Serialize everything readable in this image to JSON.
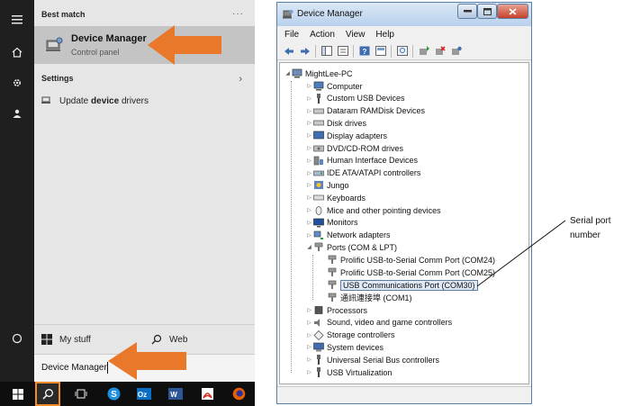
{
  "start_menu": {
    "best_match_title": "Best match",
    "more": "···",
    "best_match": {
      "title": "Device Manager",
      "subtitle": "Control panel"
    },
    "settings_title": "Settings",
    "update_drivers": {
      "before": "Update ",
      "bold": "device",
      "after": " drivers"
    },
    "my_stuff": "My stuff",
    "web": "Web",
    "search_text": "Device Manager",
    "accent_arrow": "#e9782a",
    "accent_highlight": "#f28c28"
  },
  "device_manager": {
    "title": "Device Manager",
    "menu": [
      "File",
      "Action",
      "View",
      "Help"
    ],
    "root": "MightLee-PC",
    "categories": [
      "Computer",
      "Custom USB Devices",
      "Dataram RAMDisk Devices",
      "Disk drives",
      "Display adapters",
      "DVD/CD-ROM drives",
      "Human Interface Devices",
      "IDE ATA/ATAPI controllers",
      "Jungo",
      "Keyboards",
      "Mice and other pointing devices",
      "Monitors",
      "Network adapters",
      "Ports (COM & LPT)"
    ],
    "ports": [
      "Prolific USB-to-Serial Comm Port (COM24)",
      "Prolific USB-to-Serial Comm Port (COM25)",
      "USB Communications Port (COM30)",
      "通訊連接埠 (COM1)"
    ],
    "more_categories": [
      "Processors",
      "Sound, video and game controllers",
      "Storage controllers",
      "System devices",
      "Universal Serial Bus controllers",
      "USB Virtualization"
    ]
  },
  "annotation": {
    "line1": "Serial port",
    "line2": "number"
  }
}
